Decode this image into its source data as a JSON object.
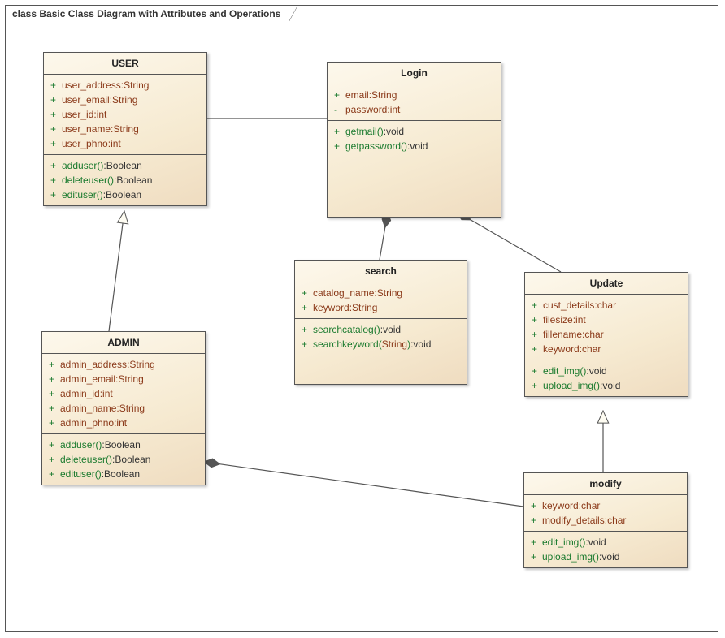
{
  "title_prefix": "class",
  "title_name": "Basic Class Diagram with Attributes and Operations",
  "classes": {
    "user": {
      "name": "USER",
      "attributes": [
        {
          "vis": "+",
          "name": "user_address",
          "type": "String"
        },
        {
          "vis": "+",
          "name": "user_email",
          "type": "String"
        },
        {
          "vis": "+",
          "name": "user_id",
          "type": "int"
        },
        {
          "vis": "+",
          "name": "user_name",
          "type": "String"
        },
        {
          "vis": "+",
          "name": "user_phno",
          "type": "int"
        }
      ],
      "operations": [
        {
          "vis": "+",
          "name": "adduser",
          "params": "",
          "ret": "Boolean"
        },
        {
          "vis": "+",
          "name": "deleteuser",
          "params": "",
          "ret": "Boolean"
        },
        {
          "vis": "+",
          "name": "edituser",
          "params": "",
          "ret": "Boolean"
        }
      ]
    },
    "login": {
      "name": "Login",
      "attributes": [
        {
          "vis": "+",
          "name": "email",
          "type": "String"
        },
        {
          "vis": "-",
          "name": "password",
          "type": "int"
        }
      ],
      "operations": [
        {
          "vis": "+",
          "name": "getmail",
          "params": "",
          "ret": "void"
        },
        {
          "vis": "+",
          "name": "getpassword",
          "params": "",
          "ret": "void"
        }
      ]
    },
    "admin": {
      "name": "ADMIN",
      "attributes": [
        {
          "vis": "+",
          "name": "admin_address",
          "type": "String"
        },
        {
          "vis": "+",
          "name": "admin_email",
          "type": "String"
        },
        {
          "vis": "+",
          "name": "admin_id",
          "type": "int"
        },
        {
          "vis": "+",
          "name": "admin_name",
          "type": "String"
        },
        {
          "vis": "+",
          "name": "admin_phno",
          "type": "int"
        }
      ],
      "operations": [
        {
          "vis": "+",
          "name": "adduser",
          "params": "",
          "ret": "Boolean"
        },
        {
          "vis": "+",
          "name": "deleteuser",
          "params": "",
          "ret": "Boolean"
        },
        {
          "vis": "+",
          "name": "edituser",
          "params": "",
          "ret": "Boolean"
        }
      ]
    },
    "search": {
      "name": "search",
      "attributes": [
        {
          "vis": "+",
          "name": "catalog_name",
          "type": "String"
        },
        {
          "vis": "+",
          "name": "keyword",
          "type": "String"
        }
      ],
      "operations": [
        {
          "vis": "+",
          "name": "searchcatalog",
          "params": "",
          "ret": "void"
        },
        {
          "vis": "+",
          "name": "searchkeyword",
          "params": "String",
          "ret": "void"
        }
      ]
    },
    "update": {
      "name": "Update",
      "attributes": [
        {
          "vis": "+",
          "name": "cust_details",
          "type": "char"
        },
        {
          "vis": "+",
          "name": "filesize",
          "type": "int"
        },
        {
          "vis": "+",
          "name": "fillename",
          "type": "char"
        },
        {
          "vis": "+",
          "name": "keyword",
          "type": "char"
        }
      ],
      "operations": [
        {
          "vis": "+",
          "name": "edit_img",
          "params": "",
          "ret": "void"
        },
        {
          "vis": "+",
          "name": "upload_img",
          "params": "",
          "ret": "void"
        }
      ]
    },
    "modify": {
      "name": "modify",
      "attributes": [
        {
          "vis": "+",
          "name": "keyword",
          "type": "char"
        },
        {
          "vis": "+",
          "name": "modify_details",
          "type": "char"
        }
      ],
      "operations": [
        {
          "vis": "+",
          "name": "edit_img",
          "params": "",
          "ret": "void"
        },
        {
          "vis": "+",
          "name": "upload_img",
          "params": "",
          "ret": "void"
        }
      ]
    }
  },
  "relationships": [
    {
      "from": "admin",
      "to": "user",
      "kind": "generalization"
    },
    {
      "from": "modify",
      "to": "update",
      "kind": "generalization"
    },
    {
      "from": "user",
      "to": "login",
      "kind": "association"
    },
    {
      "from": "login",
      "to": "search",
      "kind": "composition"
    },
    {
      "from": "login",
      "to": "update",
      "kind": "composition"
    },
    {
      "from": "admin",
      "to": "modify",
      "kind": "composition"
    }
  ]
}
